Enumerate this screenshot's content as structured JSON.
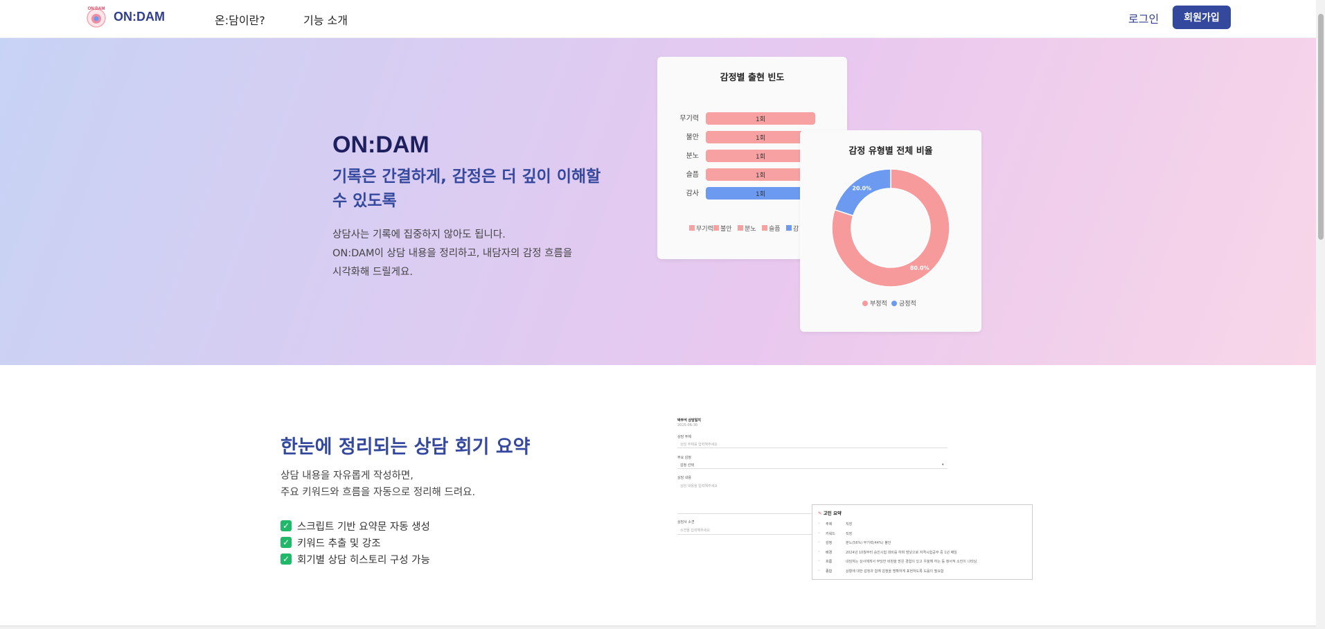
{
  "nav": {
    "logo_small_text": "ON:DAM",
    "brand": "ON:DAM",
    "link_about": "온:담이란?",
    "link_features": "기능 소개",
    "login": "로그인",
    "signup": "회원가입"
  },
  "hero": {
    "title": "ON:DAM",
    "subtitle": "기록은 간결하게, 감정은 더 깊이 이해할 수 있도록",
    "desc_line1": "상담사는 기록에 집중하지 않아도 됩니다.",
    "desc_line2": "ON:DAM이 상담 내용을 정리하고, 내담자의 감정 흐름을",
    "desc_line3": "시각화해 드릴게요."
  },
  "chart_data": [
    {
      "type": "bar",
      "title": "감정별 출현 빈도",
      "categories": [
        "무기력",
        "불안",
        "분노",
        "슬픔",
        "감사"
      ],
      "values": [
        1,
        1,
        1,
        1,
        1
      ],
      "value_labels": [
        "1회",
        "1회",
        "1회",
        "1회",
        "1회"
      ],
      "colors": [
        "#f7a1a3",
        "#f7a1a3",
        "#f7a1a3",
        "#f7a1a3",
        "#6b9af0"
      ],
      "legend": [
        "무기력",
        "불안",
        "분노",
        "슬픔",
        "감"
      ],
      "orientation": "horizontal"
    },
    {
      "type": "pie",
      "title": "감정 유형별 전체 비율",
      "labels": [
        "부정적",
        "긍정적"
      ],
      "values": [
        80.0,
        20.0
      ],
      "value_labels": [
        "80.0%",
        "20.0%"
      ],
      "colors": [
        "#f79a9c",
        "#6b9af0"
      ],
      "donut": true
    }
  ],
  "section2": {
    "title": "한눈에 정리되는 상담 회기 요약",
    "desc_line1": "상담 내용을 자유롭게 작성하면,",
    "desc_line2": "주요 키워드와 흐름을 자동으로 정리해 드려요.",
    "checks": [
      "스크립트 기반 요약문 자동 생성",
      "키워드 추출 및 강조",
      "회기별 상담 히스토리 구성 가능"
    ]
  },
  "form_preview": {
    "header": "박무석 상담일지",
    "date": "2025-06-30",
    "field1_label": "상담 주제",
    "field1_ph": "상담 주제를 입력해주세요",
    "field2_label": "주요 감정",
    "field2_value": "감정 선택",
    "field3_label": "상담 내용",
    "field3_ph": "상담 내용을 입력해주세요",
    "field4_label": "상담사 소견",
    "field4_ph": "소견을 입력해주세요",
    "summary_title": "고민 요약",
    "summary_rows": [
      {
        "k": "주제",
        "v": "직장"
      },
      {
        "k": "키워드",
        "v": "직장"
      },
      {
        "k": "감정",
        "v": "분노(56%) 무기력(44%) 불안"
      },
      {
        "k": "배경",
        "v": "2024년 10월부터 승진시험 대비를 하며 밤낮으로 자격시험공부 중 1년 째임"
      },
      {
        "k": "흐름",
        "v": "내담자는 상사에게서 부당한 비판을 받은 경험이 있고 우울해 하는 등 정서적 소진이 나타남"
      },
      {
        "k": "종합",
        "v": "상황에 대한 감정과 함께 감정을 명확하게 표현하도록 도움이 필요함"
      }
    ]
  }
}
